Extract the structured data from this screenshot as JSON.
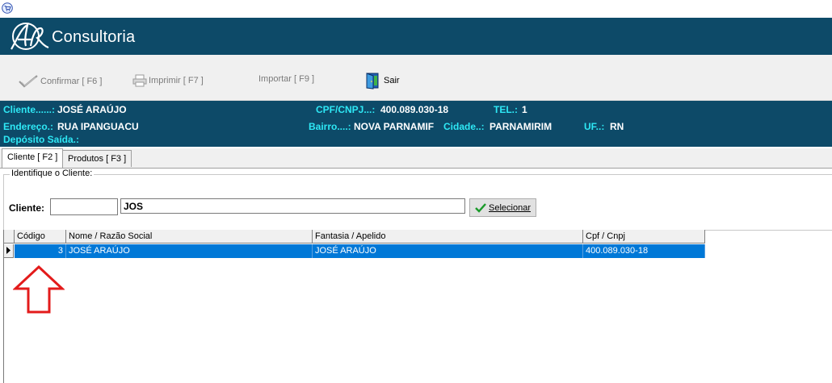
{
  "app": {
    "icon": "cart-app-icon",
    "brand": "Consultoria",
    "logo": "ar-logo"
  },
  "toolbar": {
    "confirm_label": "Confirmar [ F6 ]",
    "print_label": "Imprimir  [ F7 ]",
    "import_label": "Importar  [ F9 ]",
    "exit_label": "Sair"
  },
  "client_info": {
    "cliente_label": "Cliente......:",
    "cliente_value": "JOSÉ ARAÚJO",
    "cpf_label": "CPF/CNPJ...:",
    "cpf_value": "400.089.030-18",
    "tel_label": "TEL.:",
    "tel_value": "1",
    "endereco_label": "Endereço.:",
    "endereco_value": "RUA IPANGUACU",
    "bairro_label": "Bairro....:",
    "bairro_value": "NOVA PARNAMIF",
    "cidade_label": "Cidade..:",
    "cidade_value": "PARNAMIRIM",
    "uf_label": "UF..:",
    "uf_value": "RN",
    "deposito_label": "Depósito Saída.:"
  },
  "tabs": [
    {
      "label": "Cliente [ F2 ]",
      "active": true
    },
    {
      "label": "Produtos [ F3 ]",
      "active": false
    }
  ],
  "search": {
    "group_title": "Identifique o Cliente:",
    "cliente_label": "Cliente:",
    "code_value": "",
    "name_value": "JOS",
    "select_label": "Selecionar"
  },
  "grid": {
    "columns": [
      "Código",
      "Nome / Razão Social",
      "Fantasia / Apelido",
      "Cpf / Cnpj"
    ],
    "rows": [
      {
        "codigo": "3",
        "nome": "JOSÉ ARAÚJO",
        "fantasia": "JOSÉ ARAÚJO",
        "cpf": "400.089.030-18"
      }
    ]
  },
  "colors": {
    "banner": "#0d4a68",
    "label_cyan": "#2ee8f5",
    "selection": "#0078d7",
    "arrow": "#e31b1b"
  }
}
